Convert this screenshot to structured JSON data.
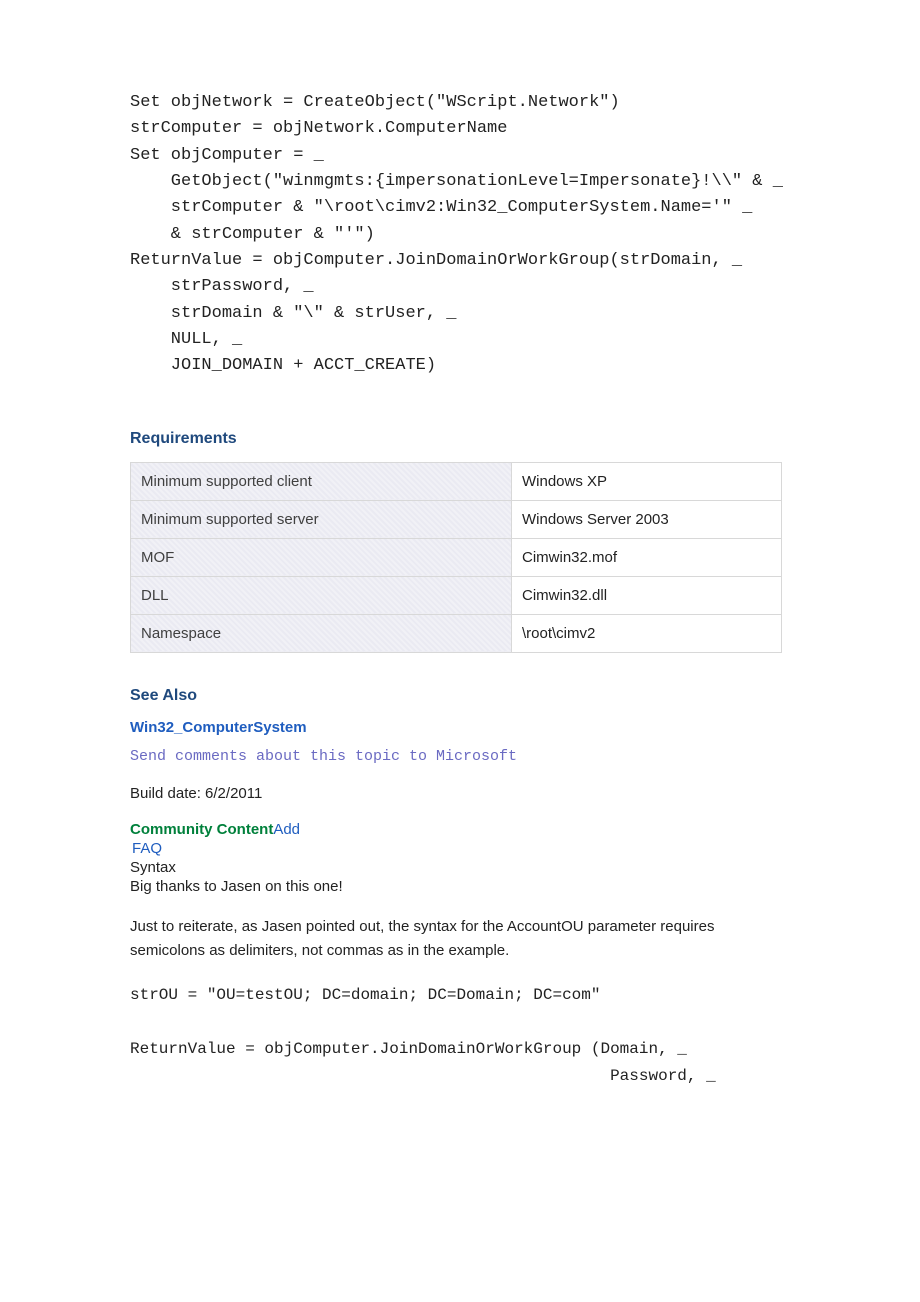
{
  "code_block_1": "Set objNetwork = CreateObject(\"WScript.Network\")\nstrComputer = objNetwork.ComputerName\nSet objComputer = _\n    GetObject(\"winmgmts:{impersonationLevel=Impersonate}!\\\\\" & _\n    strComputer & \"\\root\\cimv2:Win32_ComputerSystem.Name='\" _\n    & strComputer & \"'\")\nReturnValue = objComputer.JoinDomainOrWorkGroup(strDomain, _\n    strPassword, _\n    strDomain & \"\\\" & strUser, _\n    NULL, _\n    JOIN_DOMAIN + ACCT_CREATE)",
  "requirements": {
    "heading": "Requirements",
    "rows": [
      {
        "k": "Minimum supported client",
        "v": "Windows XP"
      },
      {
        "k": "Minimum supported server",
        "v": "Windows Server 2003"
      },
      {
        "k": "MOF",
        "v": "Cimwin32.mof"
      },
      {
        "k": "DLL",
        "v": "Cimwin32.dll"
      },
      {
        "k": "Namespace",
        "v": "\\root\\cimv2"
      }
    ]
  },
  "see_also": {
    "heading": "See Also",
    "link_text": "Win32_ComputerSystem"
  },
  "feedback_link": "Send comments about this topic to Microsoft",
  "build_date": "Build date: 6/2/2011",
  "community": {
    "label": "Community Content",
    "add": "Add",
    "faq": "FAQ",
    "syntax": "Syntax",
    "thanks": "Big thanks to Jasen on this one!",
    "body": "Just to reiterate, as Jasen pointed out, the syntax for the AccountOU parameter requires semicolons as delimiters, not commas as in the example."
  },
  "code_block_2": "strOU = \"OU=testOU; DC=domain; DC=Domain; DC=com\"\n\nReturnValue = objComputer.JoinDomainOrWorkGroup (Domain, _\n                                                  Password, _"
}
